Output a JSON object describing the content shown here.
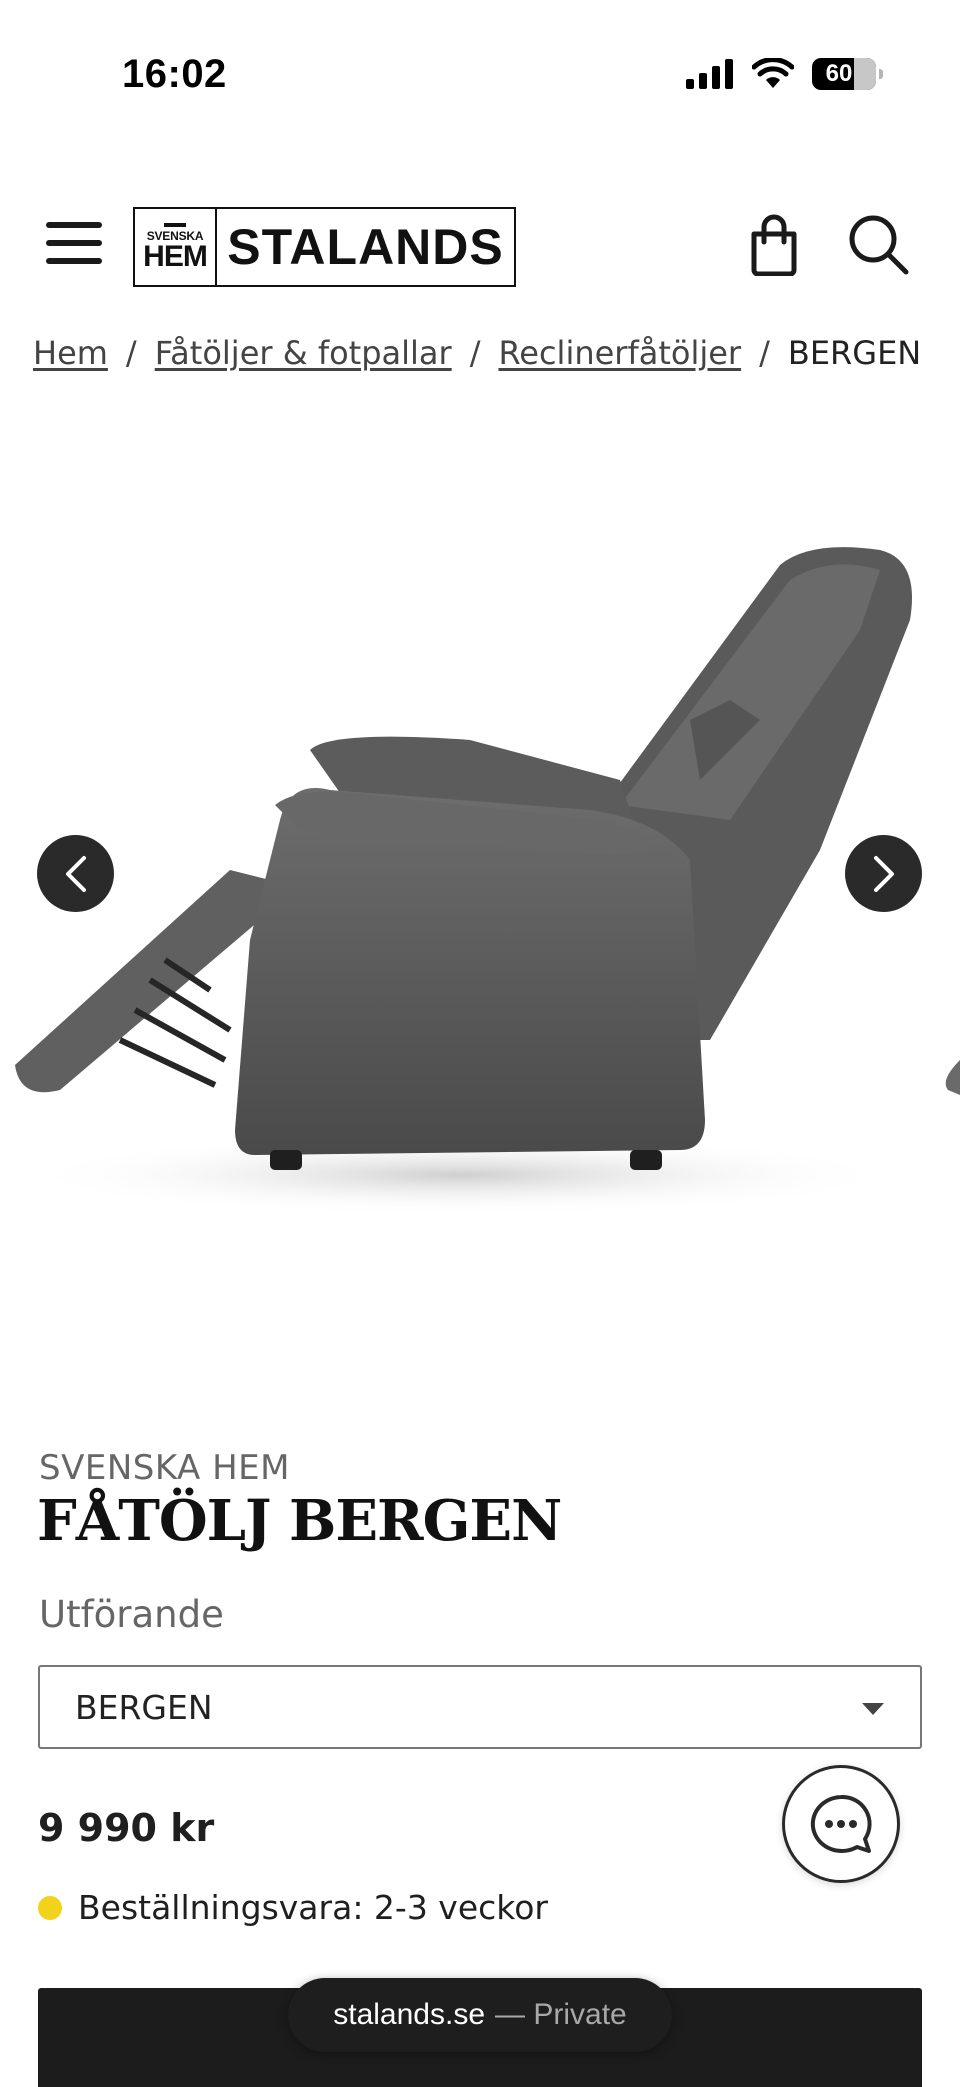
{
  "status_bar": {
    "time": "16:02",
    "battery": "60"
  },
  "header": {
    "logo_small_line1": "SVENSKA",
    "logo_small_line2": "HEM",
    "logo_main": "STALANDS",
    "icons": [
      "menu-icon",
      "shopping-bag-icon",
      "search-icon"
    ]
  },
  "breadcrumb": {
    "items": [
      "Hem",
      "Fåtöljer & fotpallar",
      "Reclinerfåtöljer"
    ],
    "current": "BERGEN",
    "separator": "/"
  },
  "product": {
    "brand": "SVENSKA HEM",
    "title": "FÅTÖLJ BERGEN",
    "variant_label": "Utförande",
    "variant_value": "BERGEN",
    "price": "9 990 kr",
    "stock_text": "Beställningsvara: 2-3 veckor",
    "stock_color": "#f2d21b"
  },
  "browser": {
    "domain": "stalands.se",
    "mode": "— Private"
  },
  "colors": {
    "dark": "#1c1c1c",
    "muted": "#666666"
  }
}
